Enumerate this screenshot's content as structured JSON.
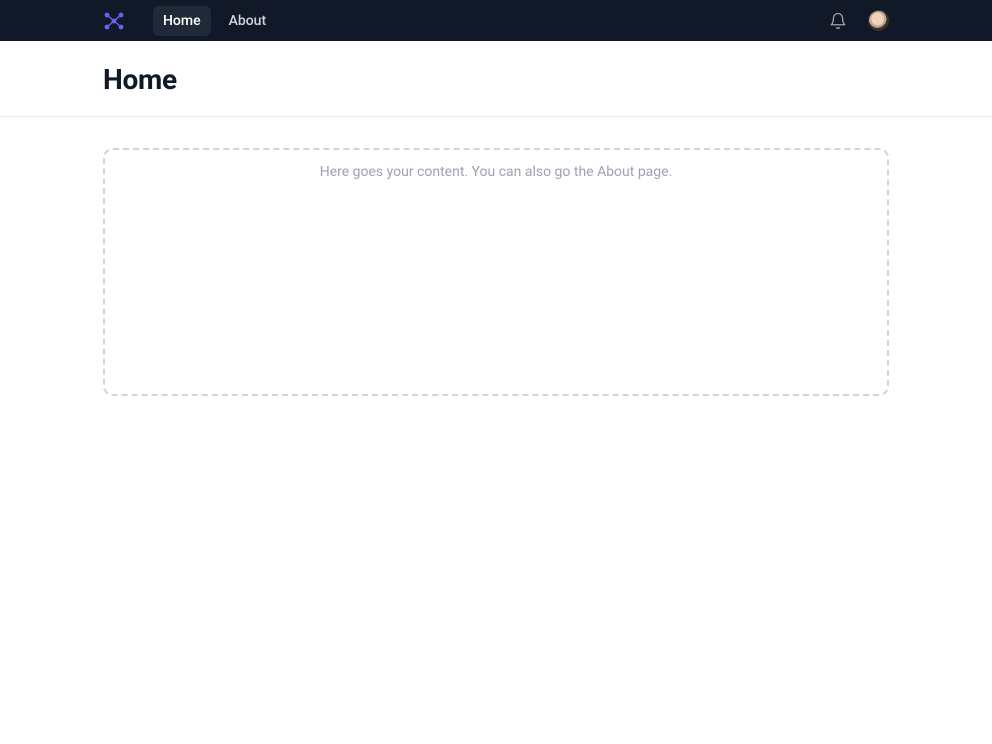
{
  "nav": {
    "home_label": "Home",
    "about_label": "About"
  },
  "header": {
    "title": "Home"
  },
  "content": {
    "placeholder_prefix": "Here goes your content. You can also go the ",
    "placeholder_link": "About",
    "placeholder_suffix": " page."
  },
  "icons": {
    "logo": "logo-icon",
    "bell": "bell-icon",
    "avatar": "avatar"
  },
  "colors": {
    "nav_bg": "#111827",
    "nav_active_bg": "#1f2937",
    "logo_accent": "#6366f1",
    "text_muted": "#9ca3af",
    "border_dashed": "#d1d5db",
    "divider": "#e5e7eb"
  }
}
